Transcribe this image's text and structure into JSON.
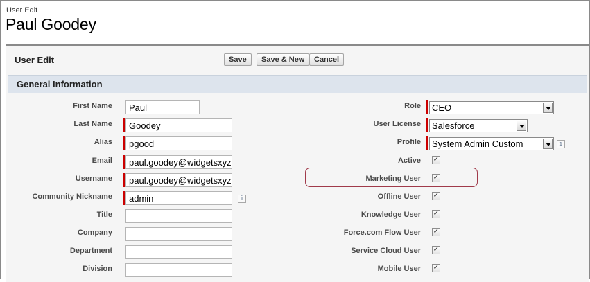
{
  "page": {
    "breadcrumb": "User Edit",
    "title": "Paul Goodey"
  },
  "block": {
    "title": "User Edit",
    "buttons": {
      "save": "Save",
      "save_new": "Save & New",
      "cancel": "Cancel"
    }
  },
  "section": {
    "title": "General Information"
  },
  "left_fields": {
    "first_name": {
      "label": "First Name",
      "value": "Paul"
    },
    "last_name": {
      "label": "Last Name",
      "value": "Goodey"
    },
    "alias": {
      "label": "Alias",
      "value": "pgood"
    },
    "email": {
      "label": "Email",
      "value": "paul.goodey@widgetsxyz"
    },
    "username": {
      "label": "Username",
      "value": "paul.goodey@widgetsxyz"
    },
    "nickname": {
      "label": "Community Nickname",
      "value": "admin"
    },
    "title": {
      "label": "Title",
      "value": ""
    },
    "company": {
      "label": "Company",
      "value": ""
    },
    "department": {
      "label": "Department",
      "value": ""
    },
    "division": {
      "label": "Division",
      "value": ""
    }
  },
  "right_fields": {
    "role": {
      "label": "Role",
      "value": "CEO"
    },
    "user_license": {
      "label": "User License",
      "value": "Salesforce"
    },
    "profile": {
      "label": "Profile",
      "value": "System Admin Custom"
    },
    "active": {
      "label": "Active",
      "checked": true
    },
    "marketing_user": {
      "label": "Marketing User",
      "checked": true
    },
    "offline_user": {
      "label": "Offline User",
      "checked": true
    },
    "knowledge_user": {
      "label": "Knowledge User",
      "checked": true
    },
    "flow_user": {
      "label": "Force.com Flow User",
      "checked": true
    },
    "service_cloud_user": {
      "label": "Service Cloud User",
      "checked": true
    },
    "mobile_user": {
      "label": "Mobile User",
      "checked": true
    }
  },
  "icons": {
    "info": "info-icon",
    "check": "✓"
  },
  "colors": {
    "required": "#cc0000",
    "section_bar": "#dde4ed",
    "highlight": "#a03a4a"
  }
}
